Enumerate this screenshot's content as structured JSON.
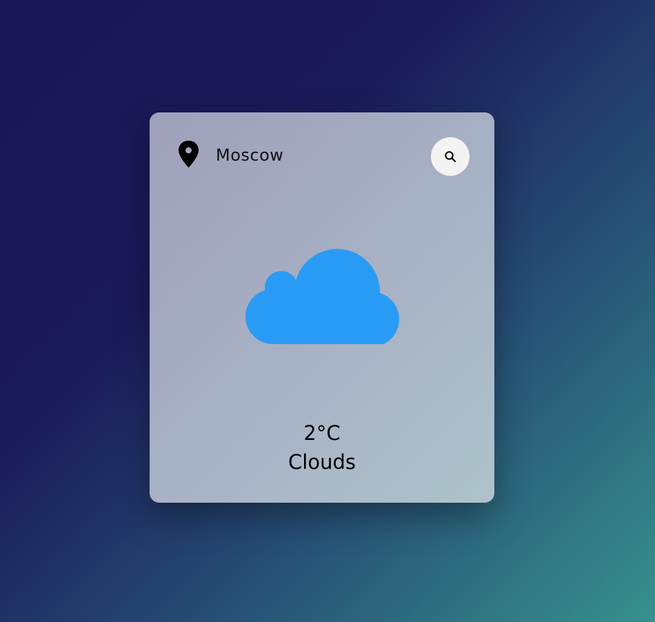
{
  "location": {
    "icon": "map-pin-icon",
    "city": "Moscow"
  },
  "search": {
    "icon": "search-icon"
  },
  "weather": {
    "icon": "cloud-icon",
    "icon_color": "#2a9bf4",
    "temperature": "2°C",
    "description": "Clouds"
  },
  "colors": {
    "background_start": "#1b1656",
    "background_end": "#37918d",
    "card": "#a7b2c5",
    "search_button": "#f3f3f3"
  }
}
